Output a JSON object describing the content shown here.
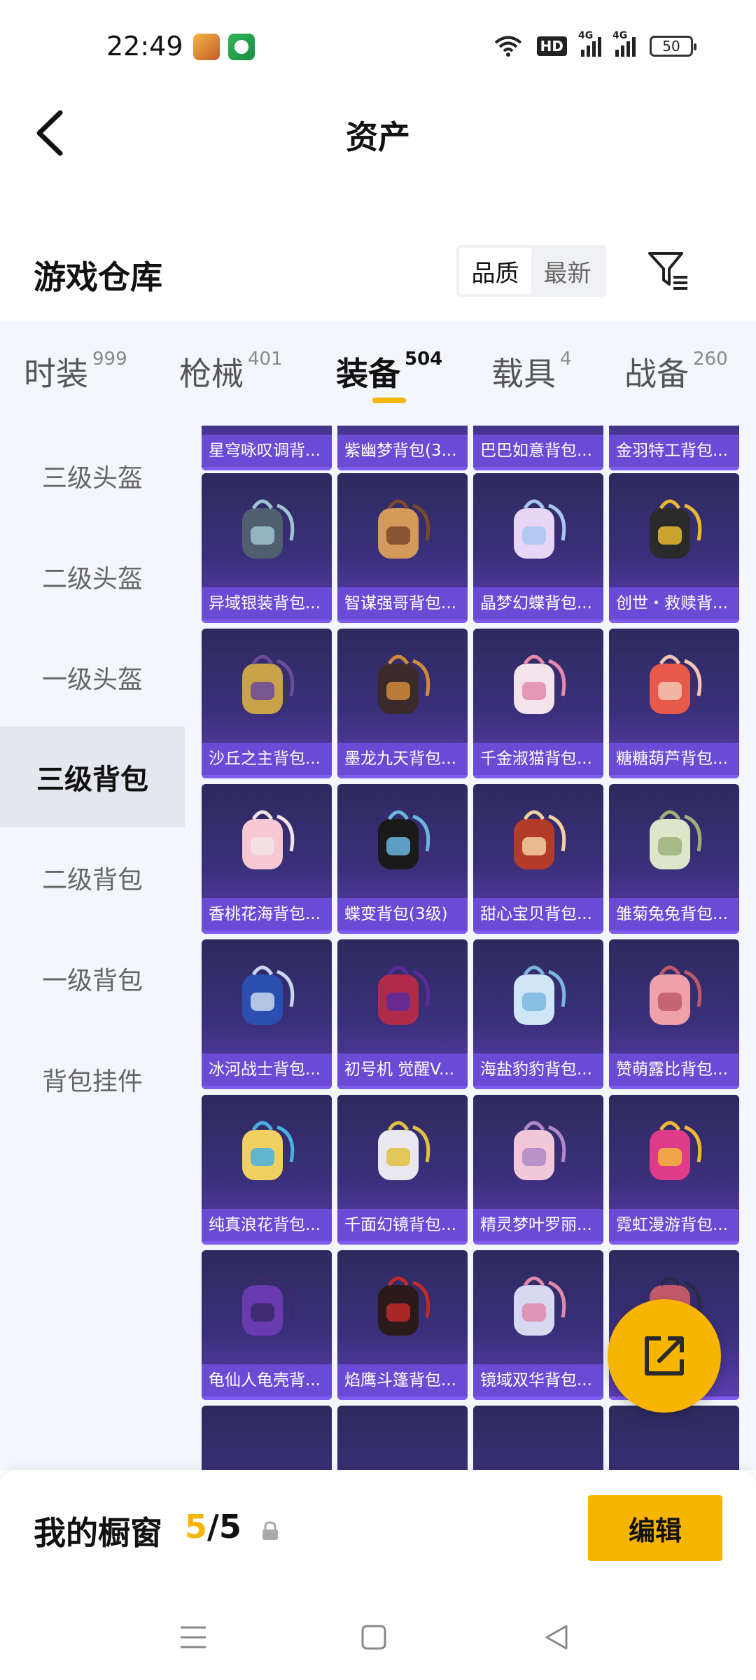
{
  "status_bar": {
    "time": "22:49",
    "hd_label": "HD",
    "network_1": "4G",
    "network_2": "4G",
    "battery": "50"
  },
  "header": {
    "title": "资产"
  },
  "section": {
    "title": "游戏仓库",
    "sort_options": [
      "品质",
      "最新"
    ],
    "active_sort": "品质"
  },
  "categories": [
    {
      "label": "时装",
      "count": "999"
    },
    {
      "label": "枪械",
      "count": "401"
    },
    {
      "label": "装备",
      "count": "504"
    },
    {
      "label": "载具",
      "count": "4"
    },
    {
      "label": "战备",
      "count": "260"
    }
  ],
  "active_category": "装备",
  "sidebar": {
    "items": [
      "三级头盔",
      "二级头盔",
      "一级头盔",
      "三级背包",
      "二级背包",
      "一级背包",
      "背包挂件"
    ],
    "active": "三级背包"
  },
  "grid": {
    "partial_top_row": [
      "星穹咏叹调背...",
      "紫幽梦背包(3...",
      "巴巴如意背包...",
      "金羽特工背包..."
    ],
    "rows": [
      [
        "异域银装背包...",
        "智谋强哥背包...",
        "晶梦幻蝶背包...",
        "创世・救赎背..."
      ],
      [
        "沙丘之主背包...",
        "墨龙九天背包...",
        "千金淑猫背包...",
        "糖糖葫芦背包..."
      ],
      [
        "香桃花海背包...",
        "蝶变背包(3级)",
        "甜心宝贝背包...",
        "雏菊兔兔背包..."
      ],
      [
        "冰河战士背包...",
        "初号机 觉醒V...",
        "海盐豹豹背包...",
        "赞萌露比背包..."
      ],
      [
        "纯真浪花背包...",
        "千面幻镜背包...",
        "精灵梦叶罗丽...",
        "霓虹漫游背包..."
      ],
      [
        "龟仙人龟壳背...",
        "焰鹰斗篷背包...",
        "镜域双华背包...",
        ""
      ]
    ],
    "card_colors": {
      "bg_top": "#2e2a5e",
      "bg_bottom": "#5a3fb0",
      "label_bg": "#6a4bd6"
    }
  },
  "showcase": {
    "title": "我的橱窗",
    "current": "5",
    "separator": "/",
    "total": "5",
    "edit_label": "编辑"
  },
  "colors": {
    "accent": "#f7b500",
    "panel_bg": "#f3f6fb"
  }
}
